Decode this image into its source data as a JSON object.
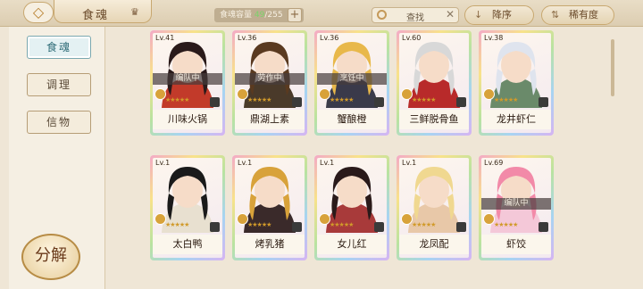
{
  "header": {
    "back_icon": "back-arrow-icon",
    "title": "食魂",
    "crown_icon": "crown-icon",
    "capacity_label": "食魂容量",
    "capacity_current": "49",
    "capacity_max": "/255",
    "search_placeholder": "查找",
    "sort_order_label": "降序",
    "sort_field_label": "稀有度"
  },
  "sidebar": {
    "tabs": [
      {
        "label": "食魂",
        "active": true
      },
      {
        "label": "调理",
        "active": false
      },
      {
        "label": "信物",
        "active": false
      }
    ],
    "decompose_label": "分解"
  },
  "colors": {
    "accent": "#c8a870",
    "active_tab": "#2f6c78",
    "capacity_highlight": "#7bd36a"
  },
  "cards": [
    {
      "level": "Lv.41",
      "status": "编队中",
      "name": "川味火锅",
      "hair": "#2a1a1a",
      "outfit": "#c23a2a"
    },
    {
      "level": "Lv.36",
      "status": "劳作中",
      "name": "鼎湖上素",
      "hair": "#5a3a20",
      "outfit": "#4a3a2a"
    },
    {
      "level": "Lv.36",
      "status": "烹饪中",
      "name": "蟹酿橙",
      "hair": "#e8b84a",
      "outfit": "#3a3a4a"
    },
    {
      "level": "Lv.60",
      "status": "",
      "name": "三鲜脱骨鱼",
      "hair": "#d8d8d8",
      "outfit": "#b82a2a"
    },
    {
      "level": "Lv.38",
      "status": "",
      "name": "龙井虾仁",
      "hair": "#dfe4ee",
      "outfit": "#6a8a6a"
    },
    {
      "level": "Lv.1",
      "status": "",
      "name": "太白鸭",
      "hair": "#1a1a1a",
      "outfit": "#e8e0d0"
    },
    {
      "level": "Lv.1",
      "status": "",
      "name": "烤乳猪",
      "hair": "#d8a23a",
      "outfit": "#3a2a2a"
    },
    {
      "level": "Lv.1",
      "status": "",
      "name": "女儿红",
      "hair": "#2a1a1a",
      "outfit": "#a83a3a"
    },
    {
      "level": "Lv.1",
      "status": "",
      "name": "龙凤配",
      "hair": "#f0d890",
      "outfit": "#e8c8a8"
    },
    {
      "level": "Lv.69",
      "status": "编队中",
      "name": "虾饺",
      "hair": "#f28aa8",
      "outfit": "#f4c8d8"
    }
  ]
}
